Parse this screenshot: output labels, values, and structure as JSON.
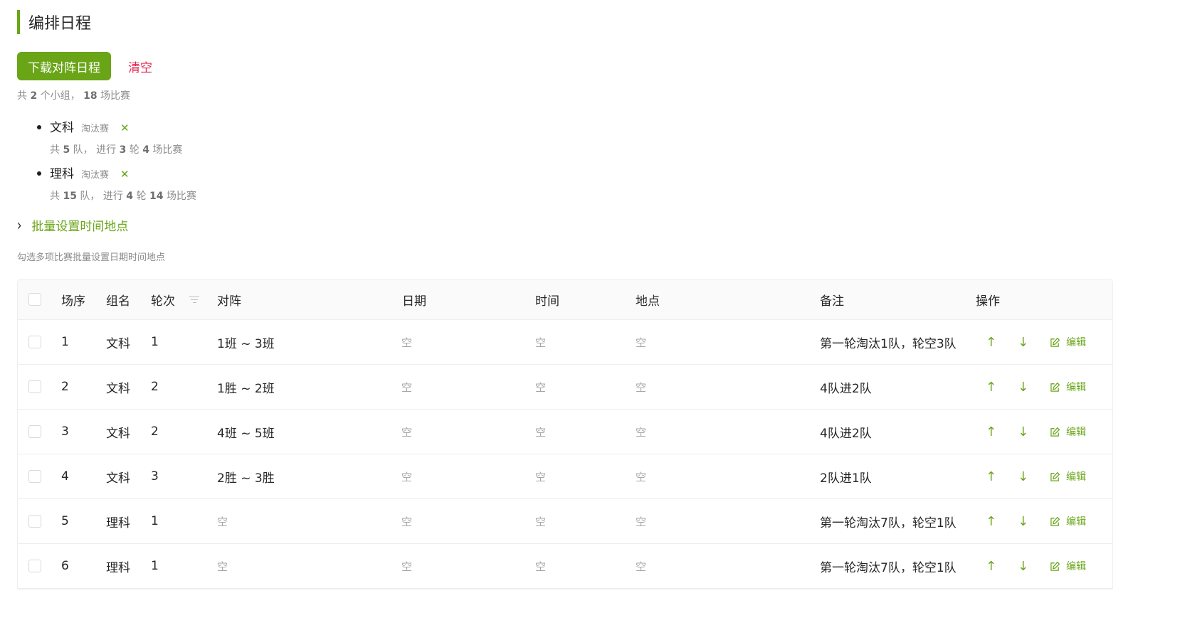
{
  "header": {
    "title": "编排日程"
  },
  "toolbar": {
    "download_label": "下载对阵日程",
    "clear_label": "清空"
  },
  "summary": {
    "prefix": "共 ",
    "groups": "2",
    "mid": " 个小组， ",
    "matches": "18",
    "suffix": " 场比赛"
  },
  "groups": [
    {
      "name": "文科",
      "type": "淘汰赛",
      "close": "✕",
      "p1": "共 ",
      "teams": "5",
      "p2": " 队， 进行 ",
      "rounds": "3",
      "p3": " 轮 ",
      "matches": "4",
      "p4": " 场比赛"
    },
    {
      "name": "理科",
      "type": "淘汰赛",
      "close": "✕",
      "p1": "共 ",
      "teams": "15",
      "p2": " 队， 进行 ",
      "rounds": "4",
      "p3": " 轮 ",
      "matches": "14",
      "p4": " 场比赛"
    }
  ],
  "batch": {
    "label": "批量设置时间地点",
    "hint": "勾选多项比赛批量设置日期时间地点"
  },
  "table": {
    "headers": {
      "order": "场序",
      "group": "组名",
      "round": "轮次",
      "matchup": "对阵",
      "date": "日期",
      "time": "时间",
      "venue": "地点",
      "note": "备注",
      "ops": "操作"
    },
    "empty": "空",
    "edit_label": "编辑",
    "rows": [
      {
        "order": "1",
        "group": "文科",
        "round": "1",
        "matchup": "1班 ~ 3班",
        "note": "第一轮淘汰1队，轮空3队"
      },
      {
        "order": "2",
        "group": "文科",
        "round": "2",
        "matchup": "1胜 ~ 2班",
        "note": "4队进2队"
      },
      {
        "order": "3",
        "group": "文科",
        "round": "2",
        "matchup": "4班 ~ 5班",
        "note": "4队进2队"
      },
      {
        "order": "4",
        "group": "文科",
        "round": "3",
        "matchup": "2胜 ~ 3胜",
        "note": "2队进1队"
      },
      {
        "order": "5",
        "group": "理科",
        "round": "1",
        "matchup": "",
        "note": "第一轮淘汰7队，轮空1队"
      },
      {
        "order": "6",
        "group": "理科",
        "round": "1",
        "matchup": "",
        "note": "第一轮淘汰7队，轮空1队"
      }
    ]
  },
  "colors": {
    "accent": "#6aa518",
    "danger": "#e0284f",
    "muted": "#8c8c8c"
  }
}
